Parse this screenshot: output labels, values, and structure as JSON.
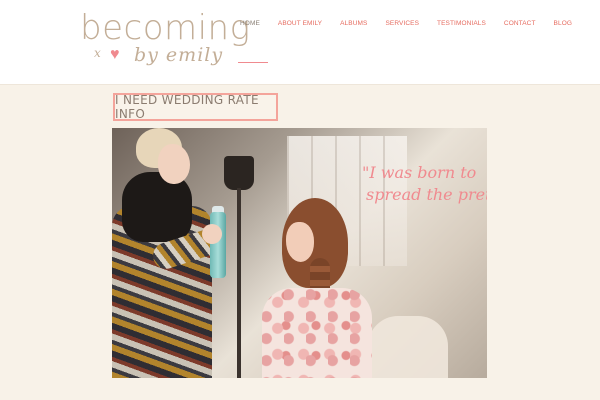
{
  "brand": {
    "name": "becoming",
    "tagline": "by emily",
    "mark": "x"
  },
  "nav": {
    "items": [
      "HOME",
      "ABOUT EMILY",
      "ALBUMS",
      "SERVICES",
      "TESTIMONIALS",
      "CONTACT",
      "BLOG"
    ],
    "active": "HOME"
  },
  "cta": {
    "label": "I NEED WEDDING RATE INFO"
  },
  "hero": {
    "quote_line1": "\"I was born to",
    "quote_line2": "spread the pretty\""
  },
  "colors": {
    "accent": "#f08a8f",
    "nav_text": "#e66b5f",
    "logo": "#c3ae97",
    "background": "#f8f2e8"
  }
}
